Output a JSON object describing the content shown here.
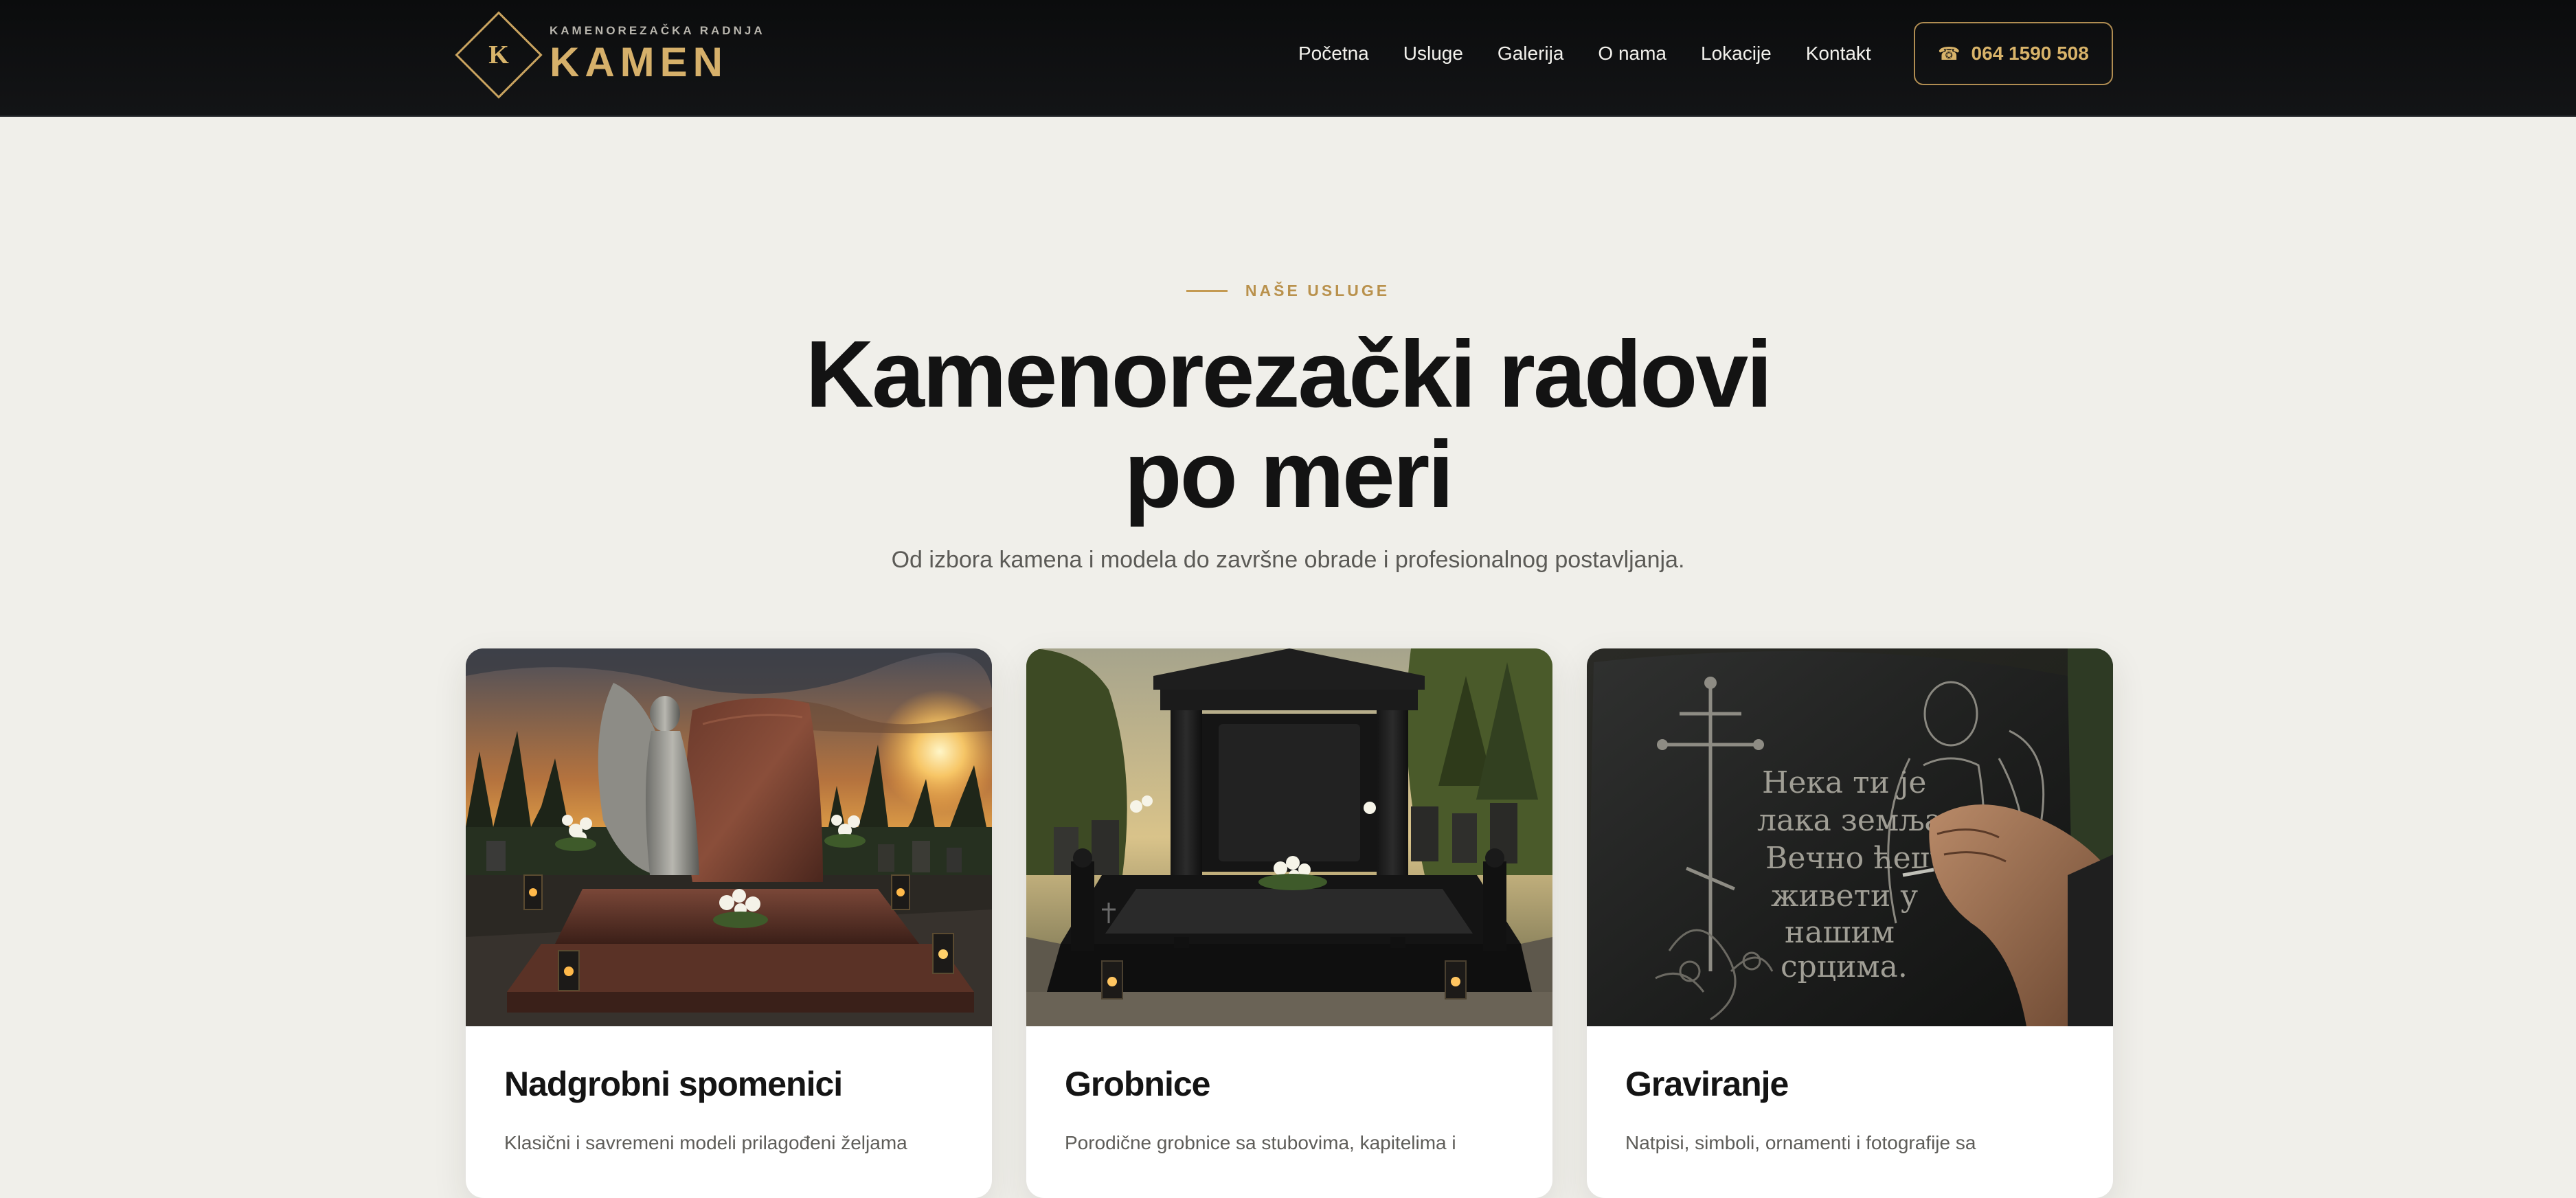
{
  "header": {
    "logo": {
      "letter": "K",
      "tagline": "KAMENOREZAČKA RADNJA",
      "name": "KAMEN"
    },
    "nav": [
      {
        "label": "Početna"
      },
      {
        "label": "Usluge"
      },
      {
        "label": "Galerija"
      },
      {
        "label": "O nama"
      },
      {
        "label": "Lokacije"
      },
      {
        "label": "Kontakt"
      }
    ],
    "phone": {
      "icon": "phone-icon",
      "glyph": "☎",
      "number": "064 1590 508"
    }
  },
  "services": {
    "kicker": "NAŠE USLUGE",
    "title_line1": "Kamenorezački radovi",
    "title_line2": "po meri",
    "subtitle": "Od izbora kamena i modela do završne obrade i profesionalnog postavljanja.",
    "cards": [
      {
        "title": "Nadgrobni spomenici",
        "text": "Klasični i savremeni modeli prilagođeni željama",
        "image_alt": "Granite monument with angel statue at sunset in a cemetery"
      },
      {
        "title": "Grobnice",
        "text": "Porodične grobnice sa stubovima, kapitelima i",
        "image_alt": "Black granite family tomb with columns and lanterns"
      },
      {
        "title": "Graviranje",
        "text": "Natpisi, simboli, ornamenti i fotografije sa",
        "image_alt": "Hand engraving Cyrillic inscription on black granite",
        "engraving_lines": [
          "Нека ти је",
          "лака земља,",
          "Вечно ћеш",
          "живети у",
          "нашим",
          "срцима."
        ]
      }
    ]
  },
  "colors": {
    "header_bg": "#0b0c0d",
    "page_bg": "#f0efea",
    "gold_accent": "#d6b06a",
    "title_text": "#131313",
    "body_text": "#5b5a56"
  }
}
